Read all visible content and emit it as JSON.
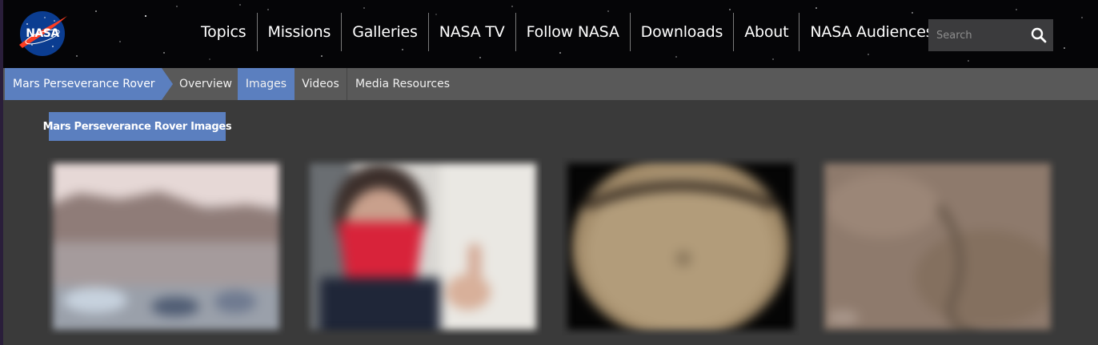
{
  "header": {
    "logo_text": "NASA",
    "nav": [
      "Topics",
      "Missions",
      "Galleries",
      "NASA TV",
      "Follow NASA",
      "Downloads",
      "About",
      "NASA Audiences"
    ],
    "search": {
      "placeholder": "Search",
      "icon": "search-icon"
    }
  },
  "subnav": {
    "breadcrumb": "Mars Perseverance Rover",
    "items": [
      {
        "label": "Overview",
        "active": false
      },
      {
        "label": "Images",
        "active": true
      },
      {
        "label": "Videos",
        "active": false
      },
      {
        "label": "Media Resources",
        "active": false
      }
    ]
  },
  "main": {
    "section_title": "Mars Perseverance Rover Images",
    "thumbnails": [
      {
        "subject": "mars-landscape"
      },
      {
        "subject": "person-in-red-mask"
      },
      {
        "subject": "circular-rock-sample"
      },
      {
        "subject": "martian-surface"
      }
    ]
  },
  "colors": {
    "accent": "#5b7fbf",
    "header_bg": "#050507",
    "subnav_bg": "#595959",
    "page_bg": "#3a3a3a"
  }
}
